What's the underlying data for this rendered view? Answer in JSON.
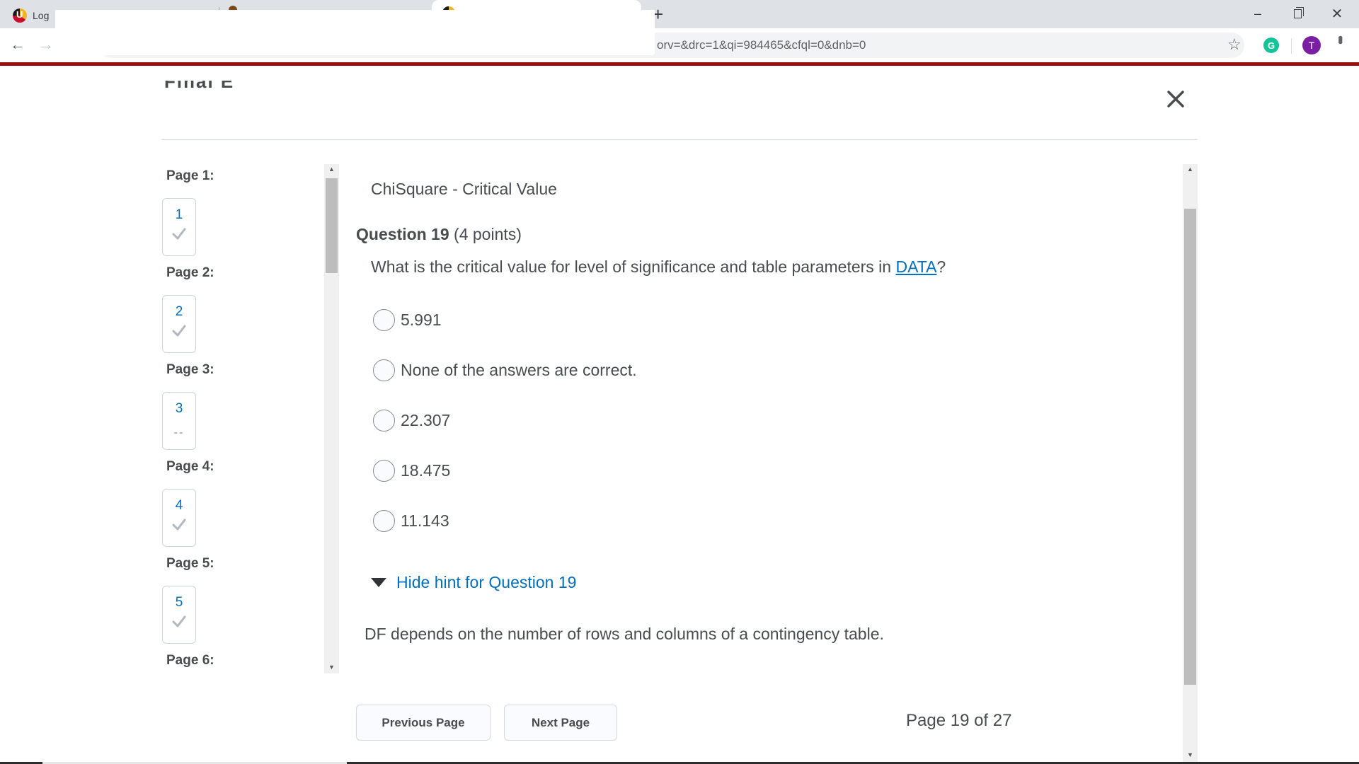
{
  "browser": {
    "tabs": [
      {
        "label": "Log",
        "active": false
      },
      {
        "label": "",
        "active": false
      },
      {
        "label": "",
        "active": true
      }
    ],
    "new_tab_icon": "+",
    "url_visible": "orv=&drc=1&qi=984465&cfql=0&dnb=0",
    "profile_initial": "T",
    "extension_initial": "G",
    "window_controls": {
      "minimize": "–",
      "close": "✕"
    },
    "colors": {
      "brand_bar": "#9b0f0f",
      "profile": "#7b1fa2",
      "grammarly": "#15c39a"
    }
  },
  "dialog": {
    "title_clipped": "Final E",
    "close_icon": "close-icon"
  },
  "sidebar": {
    "pages": [
      {
        "label": "Page 1:",
        "number": "1",
        "status": "answered"
      },
      {
        "label": "Page 2:",
        "number": "2",
        "status": "answered"
      },
      {
        "label": "Page 3:",
        "number": "3",
        "status": "unanswered",
        "status_text": "--"
      },
      {
        "label": "Page 4:",
        "number": "4",
        "status": "answered"
      },
      {
        "label": "Page 5:",
        "number": "5",
        "status": "answered"
      },
      {
        "label": "Page 6:"
      }
    ]
  },
  "question": {
    "section_title": "ChiSquare - Critical Value",
    "heading_bold": "Question 19",
    "points": "(4 points)",
    "text_before_link": "What is the critical value for level of significance and table parameters in ",
    "link_text": "DATA",
    "text_after_link": "?",
    "options": [
      {
        "label": "5.991",
        "selected": false
      },
      {
        "label": "None of the answers are correct.",
        "selected": false
      },
      {
        "label": "22.307",
        "selected": false
      },
      {
        "label": "18.475",
        "selected": false
      },
      {
        "label": "11.143",
        "selected": false
      }
    ],
    "hint_toggle": "Hide hint for Question 19",
    "hint_text": "DF depends on the number of rows and columns of a contingency table."
  },
  "footer": {
    "prev_label": "Previous Page",
    "next_label": "Next Page",
    "page_indicator": "Page 19 of 27",
    "current_page": 19,
    "total_pages": 27
  },
  "colors": {
    "link": "#006fbf",
    "text": "#494c4e"
  }
}
